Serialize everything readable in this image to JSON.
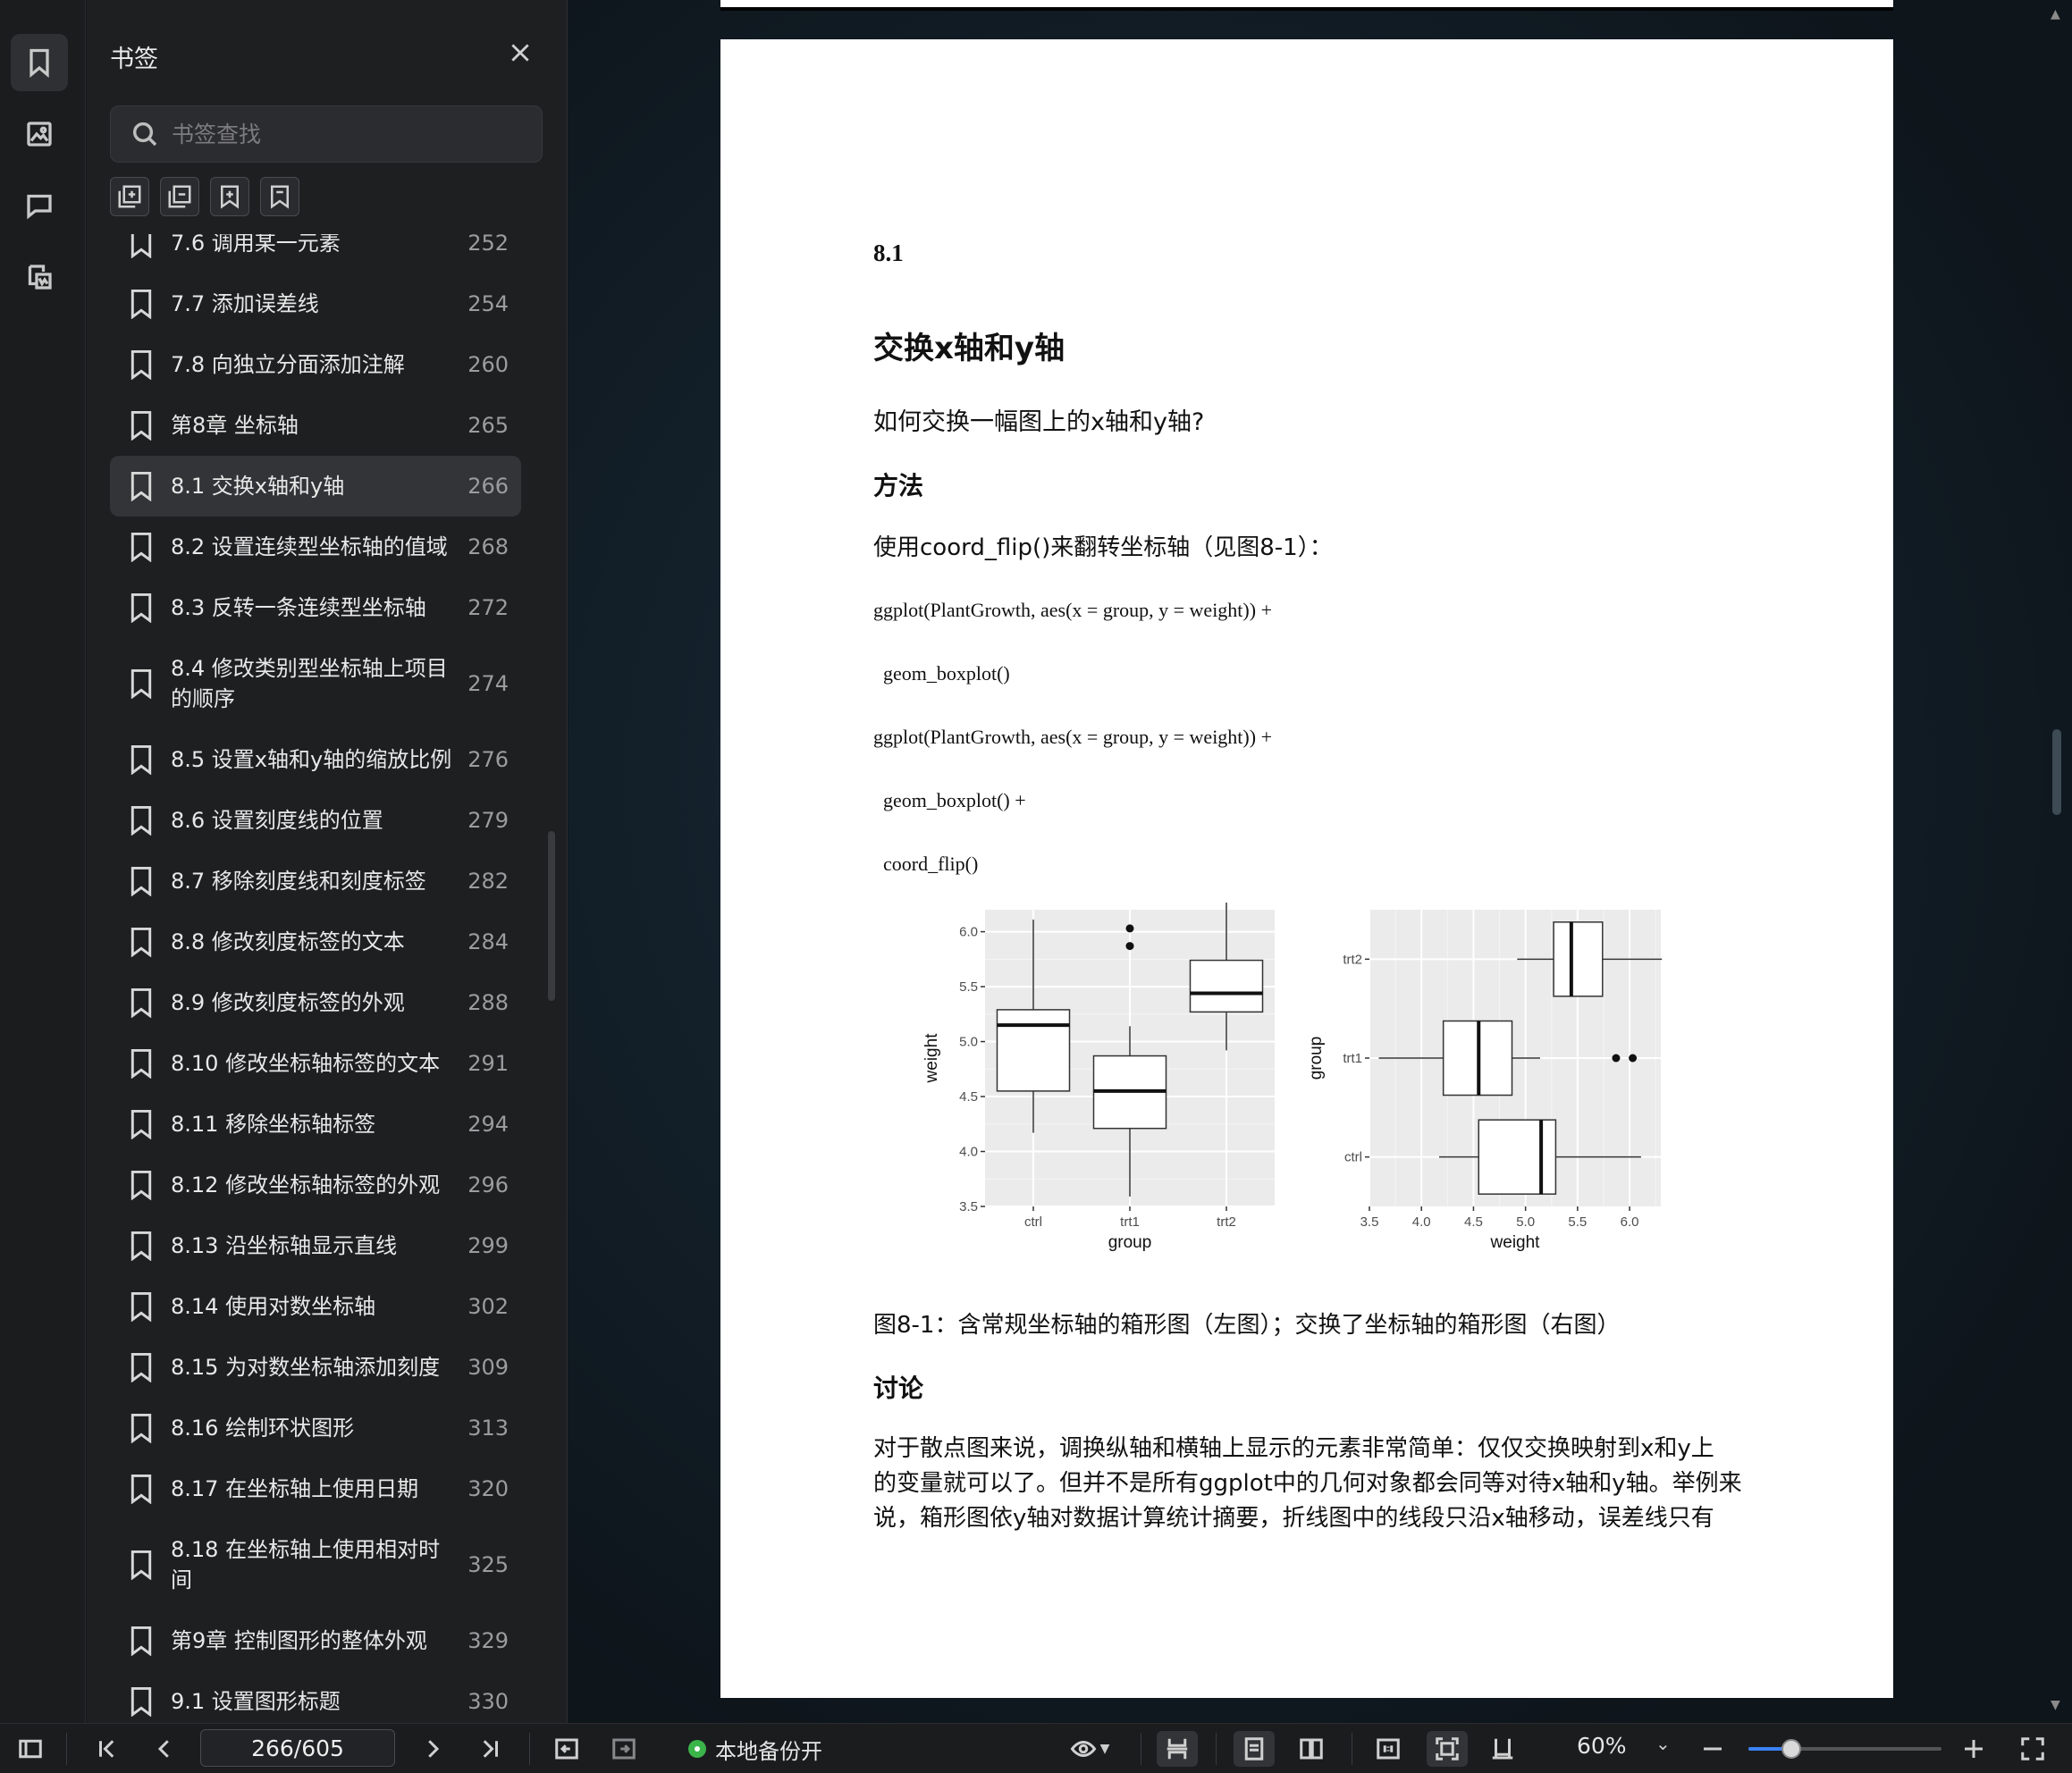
{
  "rail": {
    "items": [
      "bookmark-icon",
      "image-icon",
      "comment-icon",
      "annotation-list-icon"
    ],
    "active": 0
  },
  "panel": {
    "title": "书签",
    "search_placeholder": "书签查找",
    "tools": [
      "expand-all-icon",
      "collapse-all-icon",
      "add-bookmark-icon",
      "bookmark-outline-icon"
    ],
    "items": [
      {
        "label": "7.6 调用某一元素",
        "page": "252",
        "partial": true
      },
      {
        "label": "7.7 添加误差线",
        "page": "254"
      },
      {
        "label": "7.8 向独立分面添加注解",
        "page": "260"
      },
      {
        "label": "第8章 坐标轴",
        "page": "265"
      },
      {
        "label": "8.1 交换x轴和y轴",
        "page": "266",
        "active": true
      },
      {
        "label": "8.2 设置连续型坐标轴的值域",
        "page": "268"
      },
      {
        "label": "8.3 反转一条连续型坐标轴",
        "page": "272"
      },
      {
        "label": "8.4 修改类别型坐标轴上项目的顺序",
        "page": "274",
        "tall": true
      },
      {
        "label": "8.5 设置x轴和y轴的缩放比例",
        "page": "276"
      },
      {
        "label": "8.6 设置刻度线的位置",
        "page": "279"
      },
      {
        "label": "8.7 移除刻度线和刻度标签",
        "page": "282"
      },
      {
        "label": "8.8 修改刻度标签的文本",
        "page": "284"
      },
      {
        "label": "8.9 修改刻度标签的外观",
        "page": "288"
      },
      {
        "label": "8.10 修改坐标轴标签的文本",
        "page": "291"
      },
      {
        "label": "8.11 移除坐标轴标签",
        "page": "294"
      },
      {
        "label": "8.12 修改坐标轴标签的外观",
        "page": "296"
      },
      {
        "label": "8.13 沿坐标轴显示直线",
        "page": "299"
      },
      {
        "label": "8.14 使用对数坐标轴",
        "page": "302"
      },
      {
        "label": "8.15 为对数坐标轴添加刻度",
        "page": "309"
      },
      {
        "label": "8.16 绘制环状图形",
        "page": "313"
      },
      {
        "label": "8.17 在坐标轴上使用日期",
        "page": "320"
      },
      {
        "label": "8.18 在坐标轴上使用相对时间",
        "page": "325",
        "tall": true
      },
      {
        "label": "第9章 控制图形的整体外观",
        "page": "329"
      },
      {
        "label": "9.1 设置图形标题",
        "page": "330"
      }
    ]
  },
  "document": {
    "section_number": "8.1",
    "title": "交换x轴和y轴",
    "question": "如何交换一幅图上的x轴和y轴?",
    "method_heading": "方法",
    "method_text": "使用coord_flip()来翻转坐标轴（见图8-1）：",
    "code": [
      "ggplot(PlantGrowth, aes(x = group, y = weight)) +",
      "  geom_boxplot()",
      "ggplot(PlantGrowth, aes(x = group, y = weight)) +",
      "  geom_boxplot() +",
      "  coord_flip()"
    ],
    "caption": "图8-1：含常规坐标轴的箱形图（左图）；交换了坐标轴的箱形图（右图）",
    "discussion_heading": "讨论",
    "discussion_lines": [
      "对于散点图来说，调换纵轴和横轴上显示的元素非常简单：仅仅交换映射到x和y上",
      "的变量就可以了。但并不是所有ggplot中的几何对象都会同等对待x轴和y轴。举例来",
      "说，箱形图依y轴对数据计算统计摘要，折线图中的线段只沿x轴移动，误差线只有"
    ]
  },
  "chart_data": [
    {
      "type": "boxplot",
      "xlabel": "group",
      "ylabel": "weight",
      "categories": [
        "ctrl",
        "trt1",
        "trt2"
      ],
      "ylim": [
        3.5,
        6.2
      ],
      "yticks": [
        "3.5",
        "4.0",
        "4.5",
        "5.0",
        "5.5",
        "6.0"
      ],
      "boxes": [
        {
          "name": "ctrl",
          "min": 4.17,
          "q1": 4.55,
          "median": 5.15,
          "q3": 5.29,
          "max": 6.11,
          "outliers": []
        },
        {
          "name": "trt1",
          "min": 3.59,
          "q1": 4.21,
          "median": 4.55,
          "q3": 4.87,
          "max": 5.14,
          "outliers": [
            6.03,
            5.87
          ]
        },
        {
          "name": "trt2",
          "min": 4.92,
          "q1": 5.27,
          "median": 5.44,
          "q3": 5.74,
          "max": 6.31,
          "outliers": []
        }
      ],
      "grid": true
    },
    {
      "type": "boxplot",
      "orientation": "horizontal",
      "xlabel": "weight",
      "ylabel": "group",
      "categories": [
        "ctrl",
        "trt1",
        "trt2"
      ],
      "xlim": [
        3.5,
        6.3
      ],
      "xticks": [
        "3.5",
        "4.0",
        "4.5",
        "5.0",
        "5.5",
        "6.0"
      ],
      "boxes": [
        {
          "name": "ctrl",
          "min": 4.17,
          "q1": 4.55,
          "median": 5.15,
          "q3": 5.29,
          "max": 6.11,
          "outliers": []
        },
        {
          "name": "trt1",
          "min": 3.59,
          "q1": 4.21,
          "median": 4.55,
          "q3": 4.87,
          "max": 5.14,
          "outliers": [
            5.87,
            6.03
          ]
        },
        {
          "name": "trt2",
          "min": 4.92,
          "q1": 5.27,
          "median": 5.44,
          "q3": 5.74,
          "max": 6.31,
          "outliers": []
        }
      ],
      "grid": true
    }
  ],
  "bottombar": {
    "page_indicator": "266/605",
    "backup_label": "本地备份开",
    "zoom": "60%",
    "zoom_level": 0.22
  }
}
